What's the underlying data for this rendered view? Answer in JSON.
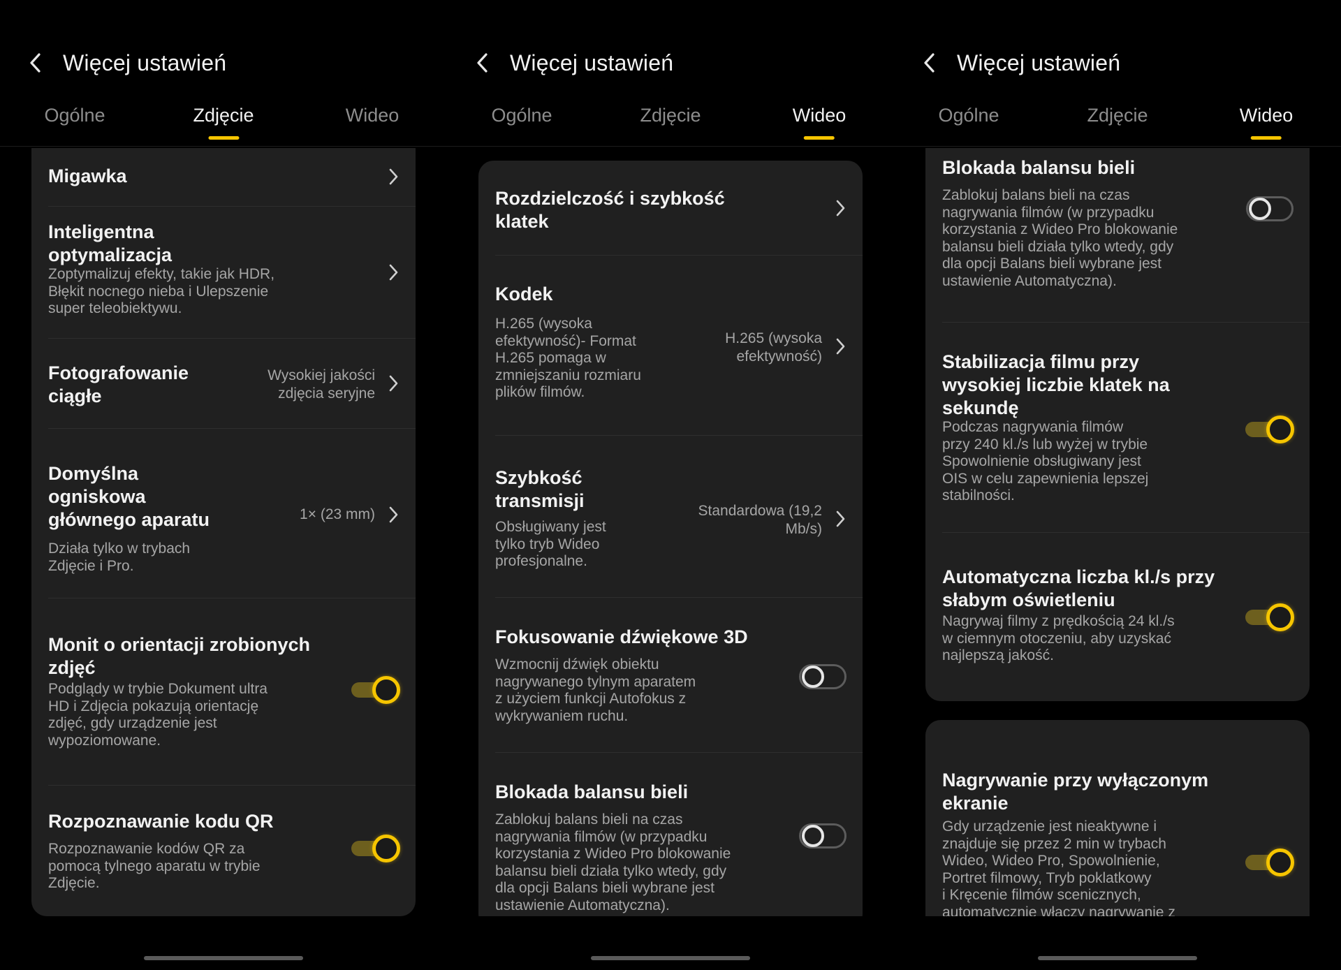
{
  "colors": {
    "accent": "#f6c500",
    "background": "#000000",
    "card": "#202020"
  },
  "screens": [
    {
      "title": "Więcej ustawień",
      "tabs": [
        "Ogólne",
        "Zdjęcie",
        "Wideo"
      ],
      "active_tab": "Zdjęcie",
      "rows": [
        {
          "title": "Migawka",
          "type": "chevron"
        },
        {
          "title": "Inteligentna\noptymalizacja",
          "desc": "Zoptymalizuj efekty, takie jak HDR,\nBłękit nocnego nieba i Ulepszenie\nsuper teleobiektywu.",
          "type": "chevron"
        },
        {
          "title": "Fotografowanie\nciągłe",
          "value": "Wysokiej jakości\nzdjęcia seryjne",
          "type": "chevron"
        },
        {
          "title": "Domyślna\nogniskowa\ngłównego aparatu",
          "desc": "Działa tylko w trybach\nZdjęcie i Pro.",
          "value": "1× (23 mm)",
          "type": "chevron"
        },
        {
          "title": "Monit o orientacji zrobionych\nzdjęć",
          "desc": "Podglądy w trybie Dokument ultra\nHD i Zdjęcia pokazują orientację\nzdjęć, gdy urządzenie jest\nwypoziomowane.",
          "type": "toggle",
          "on": true
        },
        {
          "title": "Rozpoznawanie kodu QR",
          "desc": "Rozpoznawanie kodów QR za\npomocą tylnego aparatu w trybie\nZdjęcie.",
          "type": "toggle",
          "on": true
        }
      ]
    },
    {
      "title": "Więcej ustawień",
      "tabs": [
        "Ogólne",
        "Zdjęcie",
        "Wideo"
      ],
      "active_tab": "Wideo",
      "rows": [
        {
          "title": "Rozdzielczość i szybkość\nklatek",
          "type": "chevron"
        },
        {
          "title": "Kodek",
          "desc": "H.265 (wysoka\nefektywność)- Format\nH.265 pomaga w\nzmniejszaniu rozmiaru\nplików filmów.",
          "value": "H.265 (wysoka\nefektywność)",
          "type": "chevron"
        },
        {
          "title": "Szybkość\ntransmisji",
          "desc": "Obsługiwany jest\ntylko tryb Wideo\nprofesjonalne.",
          "value": "Standardowa (19,2\nMb/s)",
          "type": "chevron"
        },
        {
          "title": "Fokusowanie dźwiękowe 3D",
          "desc": "Wzmocnij dźwięk obiektu\nnagrywanego tylnym aparatem\nz użyciem funkcji Autofokus z\nwykrywaniem ruchu.",
          "type": "toggle",
          "on": false
        },
        {
          "title": "Blokada balansu bieli",
          "desc": "Zablokuj balans bieli na czas\nnagrywania filmów (w przypadku\nkorzystania z Wideo Pro blokowanie\nbalansu bieli działa tylko wtedy, gdy\ndla opcji Balans bieli wybrane jest\nustawienie Automatyczna).",
          "type": "toggle",
          "on": false
        }
      ]
    },
    {
      "title": "Więcej ustawień",
      "tabs": [
        "Ogólne",
        "Zdjęcie",
        "Wideo"
      ],
      "active_tab": "Wideo",
      "rows": [
        {
          "title": "Blokada balansu bieli",
          "desc": "Zablokuj balans bieli na czas\nnagrywania filmów (w przypadku\nkorzystania z Wideo Pro blokowanie\nbalansu bieli działa tylko wtedy, gdy\ndla opcji Balans bieli wybrane jest\nustawienie Automatyczna).",
          "type": "toggle",
          "on": false
        },
        {
          "title": "Stabilizacja filmu przy\nwysokiej liczbie klatek na\nsekundę",
          "desc": "Podczas nagrywania filmów\nprzy 240 kl./s lub wyżej w trybie\nSpowolnienie obsługiwany jest\nOIS w celu zapewnienia lepszej\nstabilności.",
          "type": "toggle",
          "on": true
        },
        {
          "title": "Automatyczna liczba kl./s przy\nsłabym oświetleniu",
          "desc": "Nagrywaj filmy z prędkością 24 kl./s\nw ciemnym otoczeniu, aby uzyskać\nnajlepszą jakość.",
          "type": "toggle",
          "on": true
        },
        {
          "title": "Nagrywanie przy wyłączonym\nekranie",
          "desc": "Gdy urządzenie jest nieaktywne i\nznajduje się przez 2 min w trybach\nWideo, Wideo Pro, Spowolnienie,\nPortret filmowy, Tryb poklatkowy\ni Kręcenie filmów scenicznych,\nautomatycznie włączy nagrywanie z",
          "type": "toggle",
          "on": true
        }
      ]
    }
  ]
}
